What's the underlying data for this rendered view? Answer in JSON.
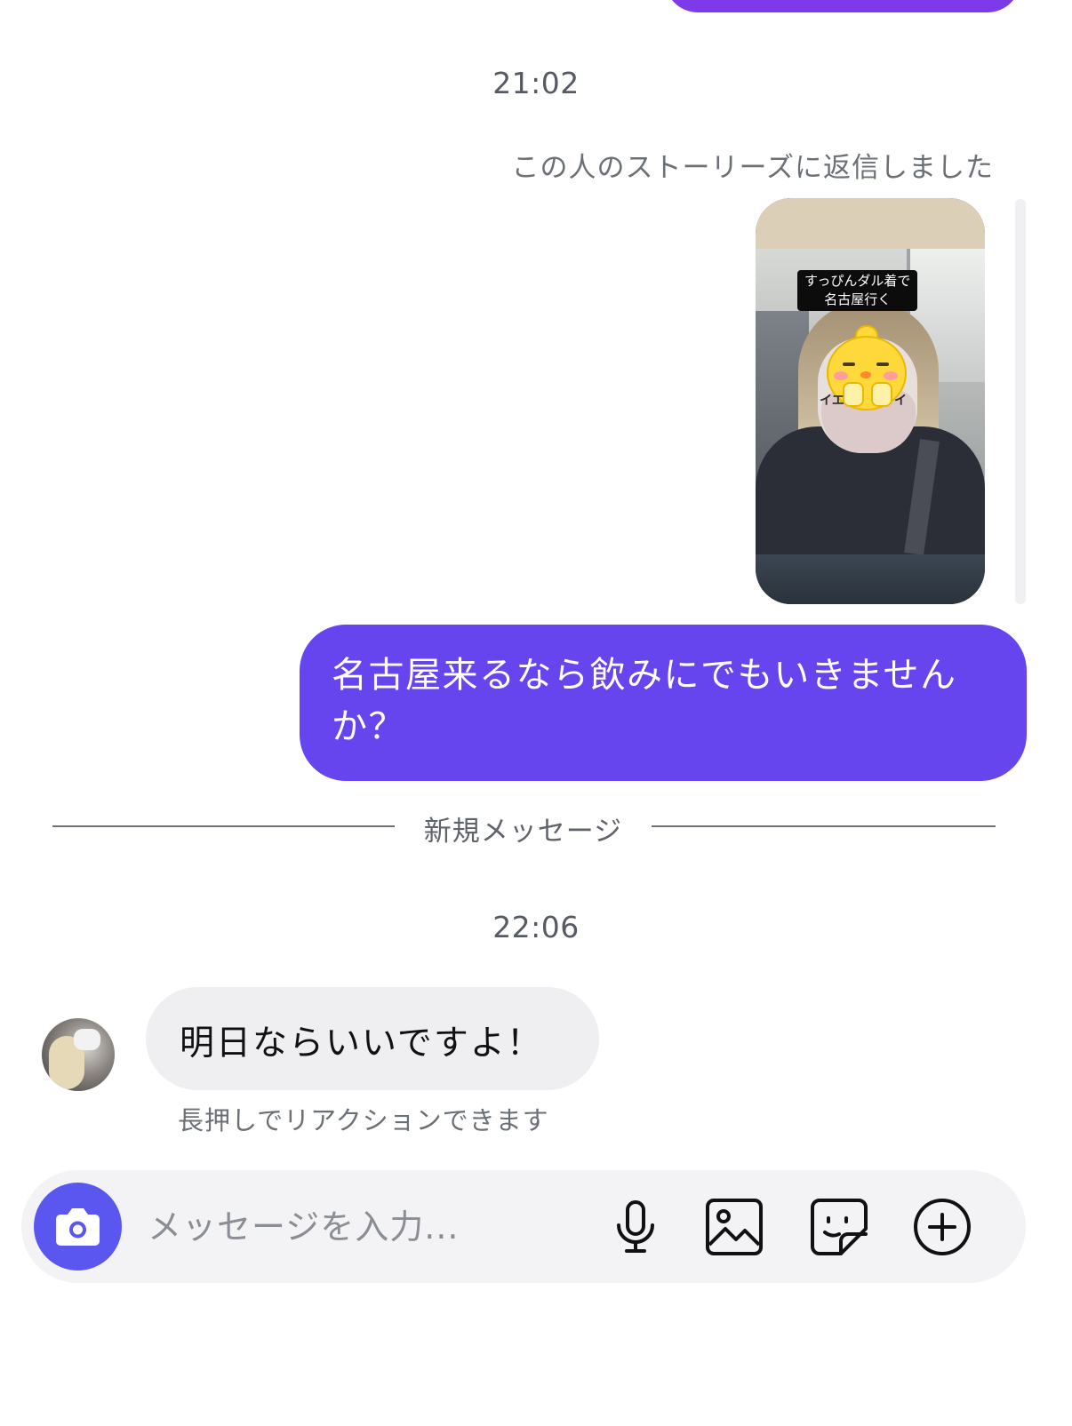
{
  "colors": {
    "sent_bubble": "#6645ef",
    "previous_bubble": "#7d3ae8",
    "received_bubble": "#efeff2",
    "camera_button": "#5a56f0"
  },
  "thread": {
    "timestamp_1": "21:02",
    "story_reply_caption": "この人のストーリーズに返信しました",
    "story_overlay_text": "すっぴんダル着で\n名古屋行く",
    "sticker_text_left": "イエ",
    "sticker_text_right": "イ",
    "sent_message": "名古屋来るなら飲みにでもいきませんか？",
    "new_messages_divider": "新規メッセージ",
    "timestamp_2": "22:06",
    "received_message": "明日ならいいですよ！",
    "reaction_hint": "長押しでリアクションできます"
  },
  "composer": {
    "placeholder": "メッセージを入力...",
    "value": "",
    "icons": [
      "camera-icon",
      "microphone-icon",
      "image-icon",
      "sticker-icon",
      "plus-circle-icon"
    ]
  }
}
